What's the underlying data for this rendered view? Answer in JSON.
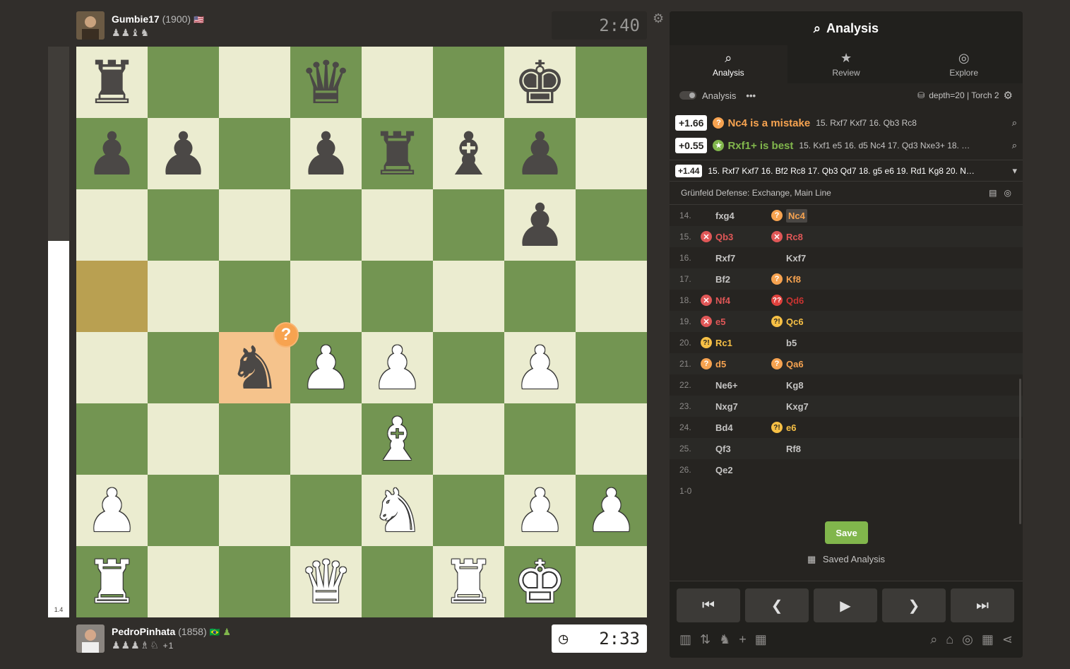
{
  "top_player": {
    "name": "Gumbie17",
    "rating": "(1900)",
    "flag": "🇺🇸",
    "captured": "♟♟♝♞",
    "clock": "2:40"
  },
  "bottom_player": {
    "name": "PedroPinhata",
    "rating": "(1858)",
    "flag": "🇧🇷",
    "captured": "♟♟♟♗♘",
    "material": "+1",
    "clock": "2:33",
    "clock_icon": "◷"
  },
  "eval_bar": {
    "label": "1.4",
    "white_fraction": 0.66
  },
  "gear_icon": "⚙",
  "board": {
    "light_color": "#ebecd0",
    "dark_color": "#739552",
    "rows": [
      [
        "r",
        "",
        "",
        "q",
        "",
        "",
        "k",
        ""
      ],
      [
        "p",
        "p",
        "",
        "p",
        "r",
        "b",
        "p",
        ""
      ],
      [
        "",
        "",
        "",
        "",
        "",
        "",
        "p",
        ""
      ],
      [
        "",
        "",
        "",
        "",
        "",
        "",
        "",
        ""
      ],
      [
        "",
        "",
        "n",
        "P",
        "P",
        "",
        "P",
        ""
      ],
      [
        "",
        "",
        "",
        "",
        "B",
        "",
        "",
        ""
      ],
      [
        "P",
        "",
        "",
        "",
        "N",
        "",
        "P",
        "P"
      ],
      [
        "R",
        "",
        "",
        "Q",
        "",
        "R",
        "K",
        ""
      ]
    ],
    "highlight": [
      [
        3,
        0
      ],
      [
        4,
        2
      ]
    ],
    "badge": {
      "row": 4,
      "col": 2,
      "symbol": "?"
    }
  },
  "panel": {
    "title": "Analysis",
    "title_icon": "⌕",
    "tabs": [
      {
        "label": "Analysis",
        "icon": "⌕",
        "active": true
      },
      {
        "label": "Review",
        "icon": "★",
        "active": false
      },
      {
        "label": "Explore",
        "icon": "◎",
        "active": false
      }
    ],
    "options": {
      "label": "Analysis",
      "more": "•••",
      "engine": "depth=20 | Torch 2"
    },
    "lines": [
      {
        "score": "+1.66",
        "icon": "?",
        "kind": "mistake",
        "verdict": "Nc4 is a mistake",
        "moves": "15. Rxf7 Kxf7 16. Qb3 Rc8"
      },
      {
        "score": "+0.55",
        "icon": "★",
        "kind": "best",
        "verdict": "Rxf1+ is best",
        "moves": "15. Kxf1 e5 16. d5 Nc4 17. Qd3 Nxe3+ 18. …"
      }
    ],
    "engine_line": {
      "score": "+1.44",
      "moves": "15. Rxf7 Kxf7 16. Bf2 Rc8 17. Qb3 Qd7 18. g5 e6 19. Rd1 Kg8 20. N…"
    },
    "opening": "Grünfeld Defense: Exchange, Main Line",
    "moves": [
      {
        "num": "14.",
        "white": "fxg4",
        "wi": "",
        "black": "Nc4",
        "bi": "q",
        "bsel": true
      },
      {
        "num": "15.",
        "white": "Qb3",
        "wi": "x",
        "black": "Rc8",
        "bi": "x"
      },
      {
        "num": "16.",
        "white": "Rxf7",
        "wi": "",
        "black": "Kxf7",
        "bi": ""
      },
      {
        "num": "17.",
        "white": "Bf2",
        "wi": "",
        "black": "Kf8",
        "bi": "q"
      },
      {
        "num": "18.",
        "white": "Nf4",
        "wi": "x",
        "black": "Qd6",
        "bi": "qq"
      },
      {
        "num": "19.",
        "white": "e5",
        "wi": "x",
        "black": "Qc6",
        "bi": "iq"
      },
      {
        "num": "20.",
        "white": "Rc1",
        "wi": "iq",
        "black": "b5",
        "bi": ""
      },
      {
        "num": "21.",
        "white": "d5",
        "wi": "q",
        "black": "Qa6",
        "bi": "q"
      },
      {
        "num": "22.",
        "white": "Ne6+",
        "wi": "",
        "black": "Kg8",
        "bi": ""
      },
      {
        "num": "23.",
        "white": "Nxg7",
        "wi": "",
        "black": "Kxg7",
        "bi": ""
      },
      {
        "num": "24.",
        "white": "Bd4",
        "wi": "",
        "black": "e6",
        "bi": "iq"
      },
      {
        "num": "25.",
        "white": "Qf3",
        "wi": "",
        "black": "Rf8",
        "bi": ""
      },
      {
        "num": "26.",
        "white": "Qe2",
        "wi": "",
        "black": "",
        "bi": ""
      }
    ],
    "result": "1-0",
    "save_label": "Save",
    "saved_label": "Saved Analysis",
    "nav": [
      "⏮",
      "❮",
      "▶",
      "❯",
      "⏭"
    ],
    "tools_left": [
      "▥",
      "⇅",
      "♞",
      "+",
      "▦"
    ],
    "tools_right": [
      "⌕",
      "⌂",
      "◎",
      "▦",
      "⋖"
    ]
  }
}
